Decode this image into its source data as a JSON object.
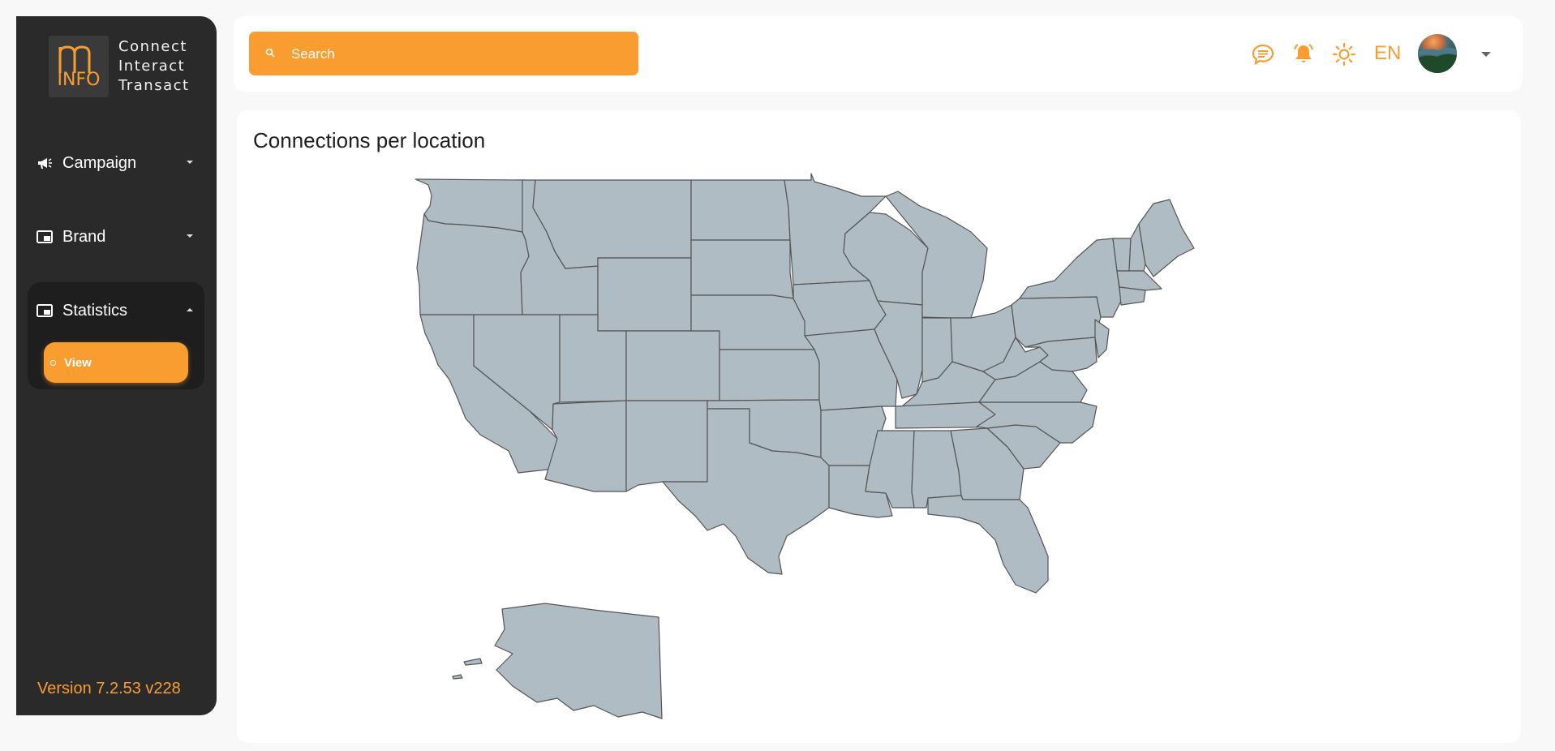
{
  "brand": {
    "logo_letters": "INFO",
    "tagline": [
      "Connect",
      "Interact",
      "Transact"
    ]
  },
  "sidebar": {
    "items": [
      {
        "label": "Campaign",
        "icon": "megaphone-icon",
        "expanded": false
      },
      {
        "label": "Brand",
        "icon": "picture-in-picture-icon",
        "expanded": false
      },
      {
        "label": "Statistics",
        "icon": "picture-in-picture-icon",
        "expanded": true,
        "children": [
          {
            "label": "View",
            "active": true
          }
        ]
      }
    ],
    "version": "Version 7.2.53 v228"
  },
  "header": {
    "search_placeholder": "Search",
    "icons": [
      "chat-icon",
      "bell-icon",
      "sun-icon"
    ],
    "language": "EN",
    "avatar": "user-avatar"
  },
  "main": {
    "card_title": "Connections per location"
  },
  "colors": {
    "accent": "#f99d31",
    "sidebar_bg": "#2a2a2a",
    "map_fill": "#afbcc3",
    "map_stroke": "#555555"
  }
}
